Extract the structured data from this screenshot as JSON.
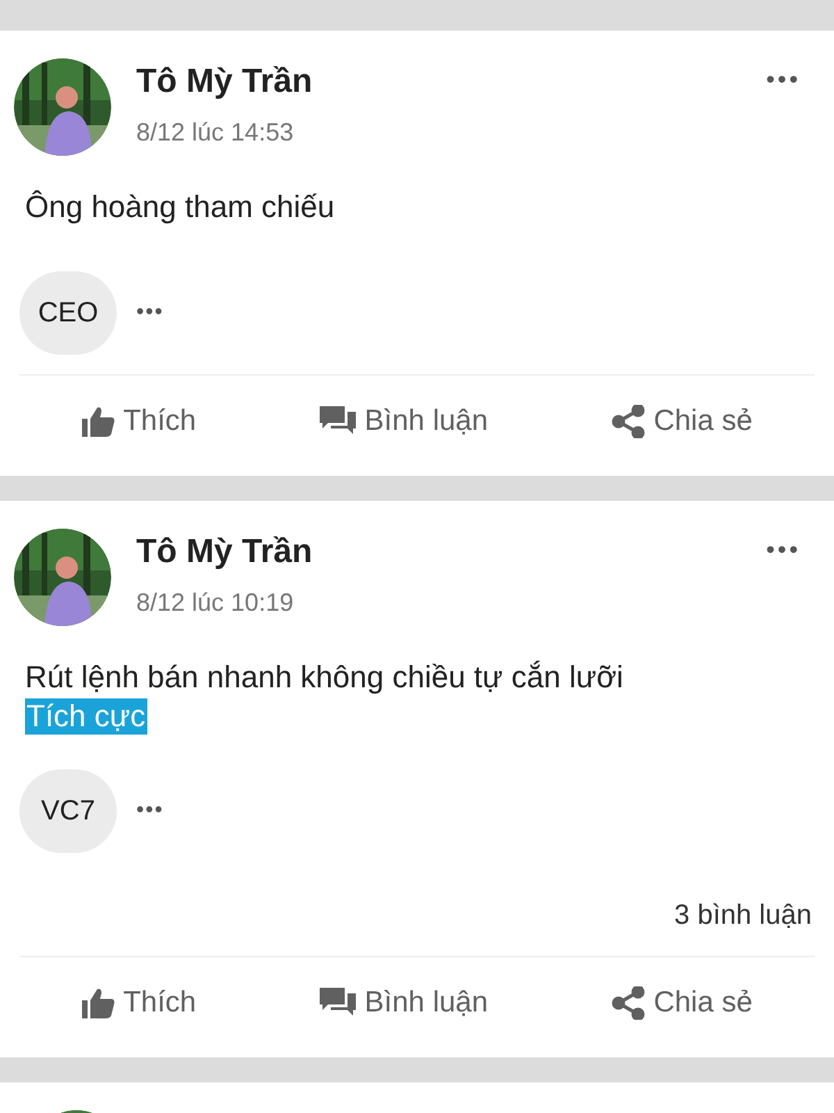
{
  "posts": [
    {
      "author": "Tô Mỳ Trần",
      "time": "8/12 lúc 14:53",
      "text": "Ông hoàng tham chiếu",
      "symbol": "CEO",
      "more": "•••",
      "actions": [
        {
          "kind": "like",
          "label": "Thích"
        },
        {
          "kind": "comment",
          "label": "Bình luận"
        },
        {
          "kind": "share",
          "label": "Chia sẻ"
        }
      ]
    },
    {
      "author": "Tô Mỳ Trần",
      "time": "8/12 lúc 10:19",
      "text": "Rút lệnh bán nhanh không chiều tự cắn lưỡi",
      "tag": "Tích cực",
      "symbol": "VC7",
      "more": "•••",
      "comment_count": "3 bình luận",
      "actions": [
        {
          "kind": "like",
          "label": "Thích"
        },
        {
          "kind": "comment",
          "label": "Bình luận"
        },
        {
          "kind": "share",
          "label": "Chia sẻ"
        }
      ]
    }
  ]
}
